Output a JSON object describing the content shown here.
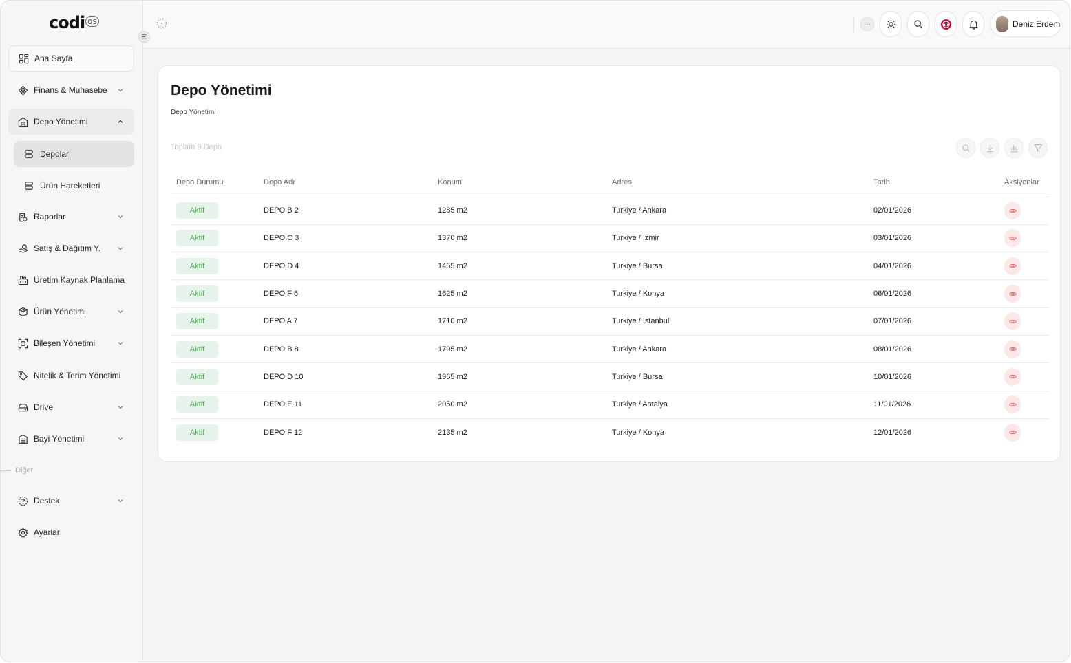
{
  "brand": {
    "logo_main": "codi",
    "logo_suffix": "os"
  },
  "sidebar": {
    "items": [
      {
        "label": "Ana Sayfa",
        "icon": "grid-icon"
      },
      {
        "label": "Finans & Muhasebe",
        "icon": "finance-icon"
      },
      {
        "label": "Depo Yönetimi",
        "icon": "warehouse-icon"
      },
      {
        "label": "Depolar",
        "icon": "server-icon"
      },
      {
        "label": "Ürün Hareketleri",
        "icon": "server-icon"
      },
      {
        "label": "Raporlar",
        "icon": "report-icon"
      },
      {
        "label": "Satış & Dağıtım Y.",
        "icon": "hand-coin-icon"
      },
      {
        "label": "Üretim Kaynak Planlama",
        "icon": "factory-icon"
      },
      {
        "label": "Ürün Yönetimi",
        "icon": "box-icon"
      },
      {
        "label": "Bileşen Yönetimi",
        "icon": "component-icon"
      },
      {
        "label": "Nitelik & Terim Yönetimi",
        "icon": "tag-icon"
      },
      {
        "label": "Drive",
        "icon": "drive-icon"
      },
      {
        "label": "Bayi Yönetimi",
        "icon": "dealer-icon"
      }
    ],
    "section_other": "Diğer",
    "other_items": [
      {
        "label": "Destek",
        "icon": "support-icon"
      },
      {
        "label": "Ayarlar",
        "icon": "gear-icon"
      }
    ]
  },
  "topbar": {
    "user_name": "Deniz Erdem",
    "more": "···"
  },
  "page": {
    "title": "Depo Yönetimi",
    "breadcrumb": "Depo Yönetimi",
    "total": "Toplam 9 Depo"
  },
  "table": {
    "columns": [
      "Depo Durumu",
      "Depo Adı",
      "Konum",
      "Adres",
      "Tarih",
      "Aksiyonlar"
    ],
    "rows": [
      {
        "status": "Aktif",
        "name": "DEPO B 2",
        "size": "1285 m2",
        "address": "Turkiye / Ankara",
        "date": "02/01/2026"
      },
      {
        "status": "Aktif",
        "name": "DEPO C 3",
        "size": "1370 m2",
        "address": "Turkiye / Izmir",
        "date": "03/01/2026"
      },
      {
        "status": "Aktif",
        "name": "DEPO D 4",
        "size": "1455 m2",
        "address": "Turkiye / Bursa",
        "date": "04/01/2026"
      },
      {
        "status": "Aktif",
        "name": "DEPO F 6",
        "size": "1625 m2",
        "address": "Turkiye / Konya",
        "date": "06/01/2026"
      },
      {
        "status": "Aktif",
        "name": "DEPO A 7",
        "size": "1710 m2",
        "address": "Turkiye / Istanbul",
        "date": "07/01/2026"
      },
      {
        "status": "Aktif",
        "name": "DEPO B 8",
        "size": "1795 m2",
        "address": "Turkiye / Ankara",
        "date": "08/01/2026"
      },
      {
        "status": "Aktif",
        "name": "DEPO D 10",
        "size": "1965 m2",
        "address": "Turkiye / Bursa",
        "date": "10/01/2026"
      },
      {
        "status": "Aktif",
        "name": "DEPO E 11",
        "size": "2050 m2",
        "address": "Turkiye / Antalya",
        "date": "11/01/2026"
      },
      {
        "status": "Aktif",
        "name": "DEPO F 12",
        "size": "2135 m2",
        "address": "Turkiye / Konya",
        "date": "12/01/2026"
      }
    ]
  },
  "colors": {
    "status_active_bg": "#e7f4ec",
    "status_active_text": "#4caf50",
    "action_bg": "#fbe9e7",
    "action_icon": "#e57373"
  }
}
